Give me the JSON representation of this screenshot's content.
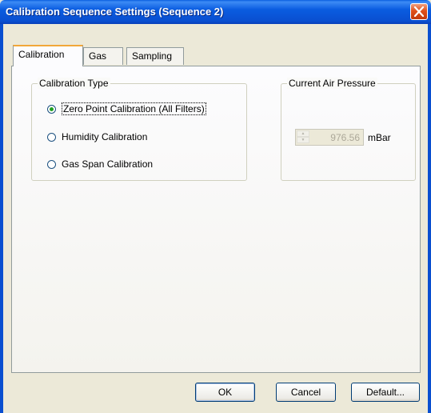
{
  "window": {
    "title": "Calibration Sequence Settings (Sequence 2)"
  },
  "tabs": [
    {
      "label": "Calibration",
      "active": true
    },
    {
      "label": "Gas",
      "active": false
    },
    {
      "label": "Sampling",
      "active": false
    }
  ],
  "calibration_type": {
    "title": "Calibration Type",
    "options": [
      {
        "label": "Zero Point Calibration (All Filters)",
        "checked": true
      },
      {
        "label": "Humidity Calibration",
        "checked": false
      },
      {
        "label": "Gas Span Calibration",
        "checked": false
      }
    ]
  },
  "air_pressure": {
    "title": "Current Air Pressure",
    "value": "976.56",
    "unit": "mBar",
    "enabled": false
  },
  "buttons": {
    "ok": "OK",
    "cancel": "Cancel",
    "default": "Default..."
  },
  "colors": {
    "titlebar": "#0a5ce0",
    "close": "#e0501a",
    "dialog_bg": "#ece9d8",
    "tab_highlight": "#f1a73a",
    "radio_dot": "#21a121"
  }
}
